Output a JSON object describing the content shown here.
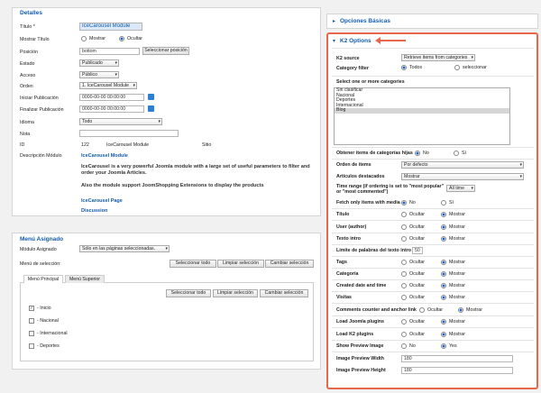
{
  "detalles": {
    "title": "Detalles",
    "titulo_label": "Título *",
    "titulo_value": "IceCarousel Module",
    "mostrar_titulo_label": "Mostrar Título",
    "mostrar_option": "Mostrar",
    "ocultar_option": "Ocultar",
    "posicion_label": "Posición",
    "posicion_value": "bottom",
    "posicion_button": "Seleccionar posición",
    "estado_label": "Estado",
    "estado_value": "Publicado",
    "acceso_label": "Acceso",
    "acceso_value": "Público",
    "orden_label": "Orden",
    "orden_value": "1. IceCarousel Module",
    "iniciar_label": "Iniciar Publicación",
    "iniciar_value": "0000-00-00 00:00:00",
    "finalizar_label": "Finalizar Publicación",
    "finalizar_value": "0000-00-00 00:00:00",
    "idioma_label": "Idioma",
    "idioma_value": "Todo",
    "nota_label": "Nota",
    "id_label": "ID",
    "id_value": "122",
    "id_name": "IceCarousel Module",
    "id_site": "Sitio",
    "desc_label": "Descripción Módulo",
    "desc_title": "IceCarousel Module",
    "desc_p1a": "IceCarousel is a very powerful Joomla module with a large set of useful parameters to filter and",
    "desc_p1b": "order your Joomla Articles.",
    "desc_p2": "Also the module support JoomShopping Extensions to display the products",
    "desc_link1": "IceCarousel Page",
    "desc_link2": "Discussion"
  },
  "menu": {
    "title": "Menú Asignado",
    "asignado_label": "Módulo Asignado",
    "asignado_value": "Sólo en las páginas seleccionadas.",
    "seleccion_label": "Menú de selección:",
    "btn_select_all": "Seleccionar todo",
    "btn_clear": "Limpiar selección",
    "btn_toggle": "Cambiar selección",
    "tab1": "Menú Principal",
    "tab2": "Menú Superior",
    "items": [
      {
        "label": "- Inicio",
        "checked": true
      },
      {
        "label": "- Nacional",
        "checked": false
      },
      {
        "label": "- Internacional",
        "checked": false
      },
      {
        "label": "- Deportes",
        "checked": false
      }
    ]
  },
  "opciones_basicas": "Opciones Básicas",
  "k2": {
    "title": "K2 Options",
    "source_label": "K2 source",
    "source_value": "Retrieve items from categories",
    "filter_label": "Category filter",
    "filter_all": "Todos",
    "filter_select": "seleccionar",
    "select_label": "Select one or more categories",
    "categories": [
      "Sin clasificar",
      "Nacional",
      "Deportes",
      "Internacional",
      "Blog"
    ],
    "child_label": "Obtener items de categorías hijas",
    "orden_label": "Orden de items",
    "orden_value": "Por defecto",
    "destacados_label": "Artículos destacados",
    "destacados_value": "Mostrar",
    "time_label_1": "Time range (if ordering is set to \"most popular\"",
    "time_label_2": "or \"most commented\")",
    "time_value": "All time",
    "fetch_label": "Fetch only items with media",
    "titulo_label": "Título",
    "user_label": "User (author)",
    "texto_label": "Texto intro",
    "limite_label": "Límite de palabras del texto intro",
    "limite_value": "50",
    "tags_label": "Tags",
    "categoria_label": "Categoría",
    "created_label": "Created date and time",
    "visitas_label": "Visitas",
    "comments_label": "Comments counter and anchor link",
    "joomla_label": "Load Joomla plugins",
    "k2plugins_label": "Load K2 plugins",
    "preview_label": "Show Preview Image",
    "width_label": "Image Preview Width",
    "width_value": "180",
    "height_label": "Image Preview Height",
    "height_value": "180",
    "no": "No",
    "si": "Sí",
    "yes": "Yes",
    "ocultar": "Ocultar",
    "mostrar": "Mostrar"
  },
  "colors": {
    "accent": "#e8674a",
    "link": "#135cae"
  }
}
